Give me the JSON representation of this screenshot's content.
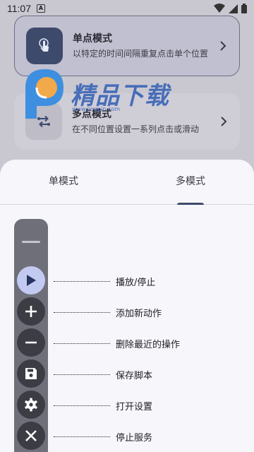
{
  "status_bar": {
    "time": "11:07",
    "notification_icon": "A"
  },
  "cards": {
    "single": {
      "title": "单点模式",
      "description": "以特定的时间间隔重复点击单个位置"
    },
    "multi": {
      "title": "多点模式",
      "description": "在不同位置设置一系列点击或滑动"
    }
  },
  "watermark": {
    "text": "精品下载",
    "url": "www.jingpin.com"
  },
  "tabs": [
    {
      "label": "单模式",
      "selected": false
    },
    {
      "label": "多模式",
      "selected": true
    }
  ],
  "legend": [
    {
      "icon": "play-icon",
      "label": "播放/停止"
    },
    {
      "icon": "plus-icon",
      "label": "添加新动作"
    },
    {
      "icon": "minus-icon",
      "label": "删除最近的操作"
    },
    {
      "icon": "save-icon",
      "label": "保存脚本"
    },
    {
      "icon": "gear-icon",
      "label": "打开设置"
    },
    {
      "icon": "close-icon",
      "label": "停止服务"
    }
  ],
  "colors": {
    "accent": "#3e4a6c",
    "active_button": "#c3caf2",
    "toolbar": "#6e6f78"
  }
}
